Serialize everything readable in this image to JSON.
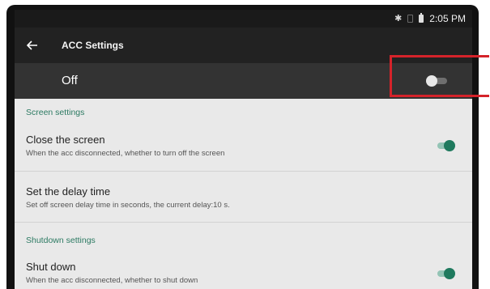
{
  "status_bar": {
    "time": "2:05 PM",
    "icons": [
      "bluetooth-icon",
      "no-sim-icon",
      "battery-icon"
    ]
  },
  "toolbar": {
    "title": "ACC Settings",
    "back_icon": "arrow-left-icon"
  },
  "master": {
    "label": "Off",
    "enabled": false
  },
  "sections": {
    "screen": {
      "header": "Screen settings",
      "close_screen": {
        "title": "Close the screen",
        "subtitle": "When the acc disconnected, whether to turn off the screen",
        "enabled": true
      },
      "delay": {
        "title": "Set the delay time",
        "subtitle": "Set off screen delay time in seconds, the current delay:10 s."
      }
    },
    "shutdown": {
      "header": "Shutdown settings",
      "shut_down": {
        "title": "Shut down",
        "subtitle": "When the acc disconnected, whether to shut down",
        "enabled": true
      }
    }
  },
  "colors": {
    "accent": "#1f7a5e",
    "highlight": "#d5232a",
    "toolbar": "#222222"
  }
}
